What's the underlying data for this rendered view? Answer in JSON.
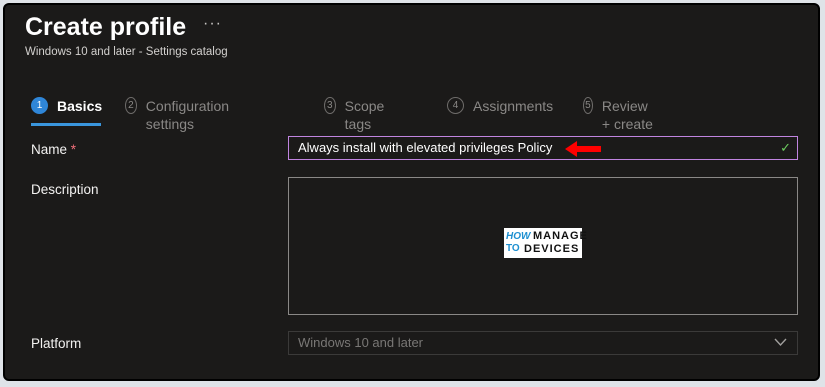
{
  "header": {
    "title": "Create profile",
    "more_glyph": "···",
    "subtitle": "Windows 10 and later - Settings catalog"
  },
  "steps": [
    {
      "num": "1",
      "label": "Basics",
      "active": true
    },
    {
      "num": "2",
      "label": "Configuration settings",
      "active": false
    },
    {
      "num": "3",
      "label": "Scope tags",
      "active": false
    },
    {
      "num": "4",
      "label": "Assignments",
      "active": false
    },
    {
      "num": "5",
      "label": "Review + create",
      "active": false
    }
  ],
  "form": {
    "name_label": "Name",
    "required_mark": "*",
    "name_value": "Always install with elevated privileges Policy",
    "description_label": "Description",
    "description_value": "",
    "platform_label": "Platform",
    "platform_value": "Windows 10 and later"
  },
  "watermark": {
    "how": "HOW",
    "to": "TO",
    "manage": "MANAGE",
    "devices": "DEVICES"
  },
  "colors": {
    "accent": "#3a96dd",
    "annotation_arrow": "#ff0000",
    "valid_check": "#6ccb5f",
    "focus_border": "#c084e0"
  },
  "icons": {
    "check": "checkmark-icon",
    "chevron": "chevron-down-icon",
    "more": "more-options-icon",
    "arrow": "red-arrow-annotation"
  }
}
